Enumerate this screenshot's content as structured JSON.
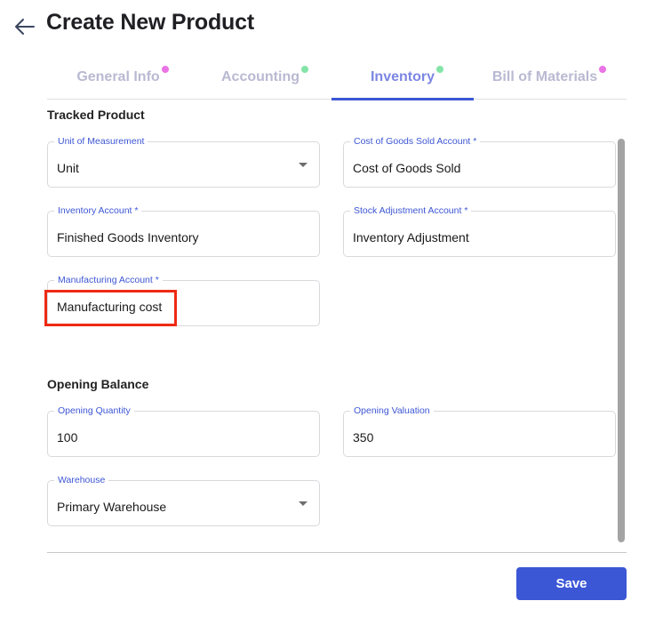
{
  "header": {
    "back_icon": "arrow-left-icon",
    "title": "Create New Product"
  },
  "tabs": [
    {
      "label": "General Info",
      "dot_color": "#ea73e6",
      "active": false
    },
    {
      "label": "Accounting",
      "dot_color": "#84e4a8",
      "active": false
    },
    {
      "label": "Inventory",
      "dot_color": "#84e4a8",
      "active": true
    },
    {
      "label": "Bill of Materials",
      "dot_color": "#ea73e6",
      "active": false
    }
  ],
  "tracked_product": {
    "title": "Tracked Product",
    "unit_of_measurement": {
      "label": "Unit of Measurement",
      "value": "Unit"
    },
    "cogs_account": {
      "label": "Cost of Goods Sold Account *",
      "value": "Cost of Goods Sold"
    },
    "inventory_account": {
      "label": "Inventory Account *",
      "value": "Finished Goods Inventory"
    },
    "stock_adjustment_account": {
      "label": "Stock Adjustment Account *",
      "value": "Inventory Adjustment"
    },
    "manufacturing_account": {
      "label": "Manufacturing Account *",
      "value": "Manufacturing cost"
    }
  },
  "opening_balance": {
    "title": "Opening Balance",
    "opening_quantity": {
      "label": "Opening Quantity",
      "value": "100"
    },
    "opening_valuation": {
      "label": "Opening Valuation",
      "value": "350"
    },
    "warehouse": {
      "label": "Warehouse",
      "value": "Primary Warehouse"
    }
  },
  "footer": {
    "save_label": "Save"
  },
  "colors": {
    "accent": "#3b57d6",
    "highlight": "#ee2a12",
    "active_tab_text": "#7c86e3",
    "inactive_tab_text": "#b9b9d2"
  }
}
